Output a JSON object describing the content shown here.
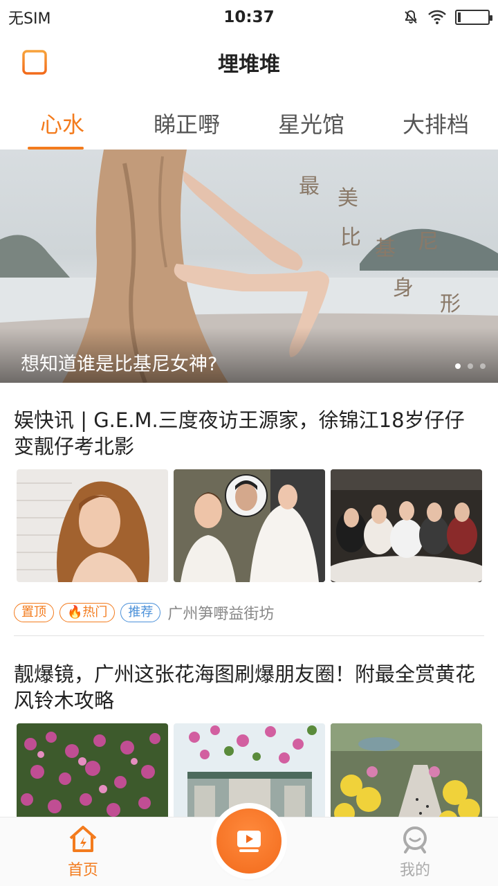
{
  "status_bar": {
    "carrier": "无SIM",
    "time": "10:37",
    "battery_level": 0.1
  },
  "app_bar": {
    "title": "埋堆堆",
    "left_icon": "document-list-icon"
  },
  "tabs": [
    {
      "label": "心水",
      "active": true
    },
    {
      "label": "睇正嘢",
      "active": false
    },
    {
      "label": "星光馆",
      "active": false
    },
    {
      "label": "大排档",
      "active": false
    }
  ],
  "banner": {
    "caption": "想知道谁是比基尼女神?",
    "overlay_text": [
      "最",
      "美",
      "比",
      "基",
      "尼",
      "身",
      "形"
    ],
    "slide_count": 3,
    "active_slide": 1
  },
  "articles": [
    {
      "title": "娱快讯 | G.E.M.三度夜访王源家，徐锦江18岁仔仔变靓仔考北影",
      "tags": [
        "置顶",
        "热门",
        "推荐"
      ],
      "source": "广州笋嘢益街坊"
    },
    {
      "title": "靓爆镜，广州这张花海图刷爆朋友圈！附最全赏黄花风铃木攻略"
    }
  ],
  "bottom_nav": {
    "home_label": "首页",
    "me_label": "我的",
    "center_icon": "video-play-icon"
  },
  "colors": {
    "accent": "#f37b1d",
    "recommend_tag": "#4a90d9"
  }
}
